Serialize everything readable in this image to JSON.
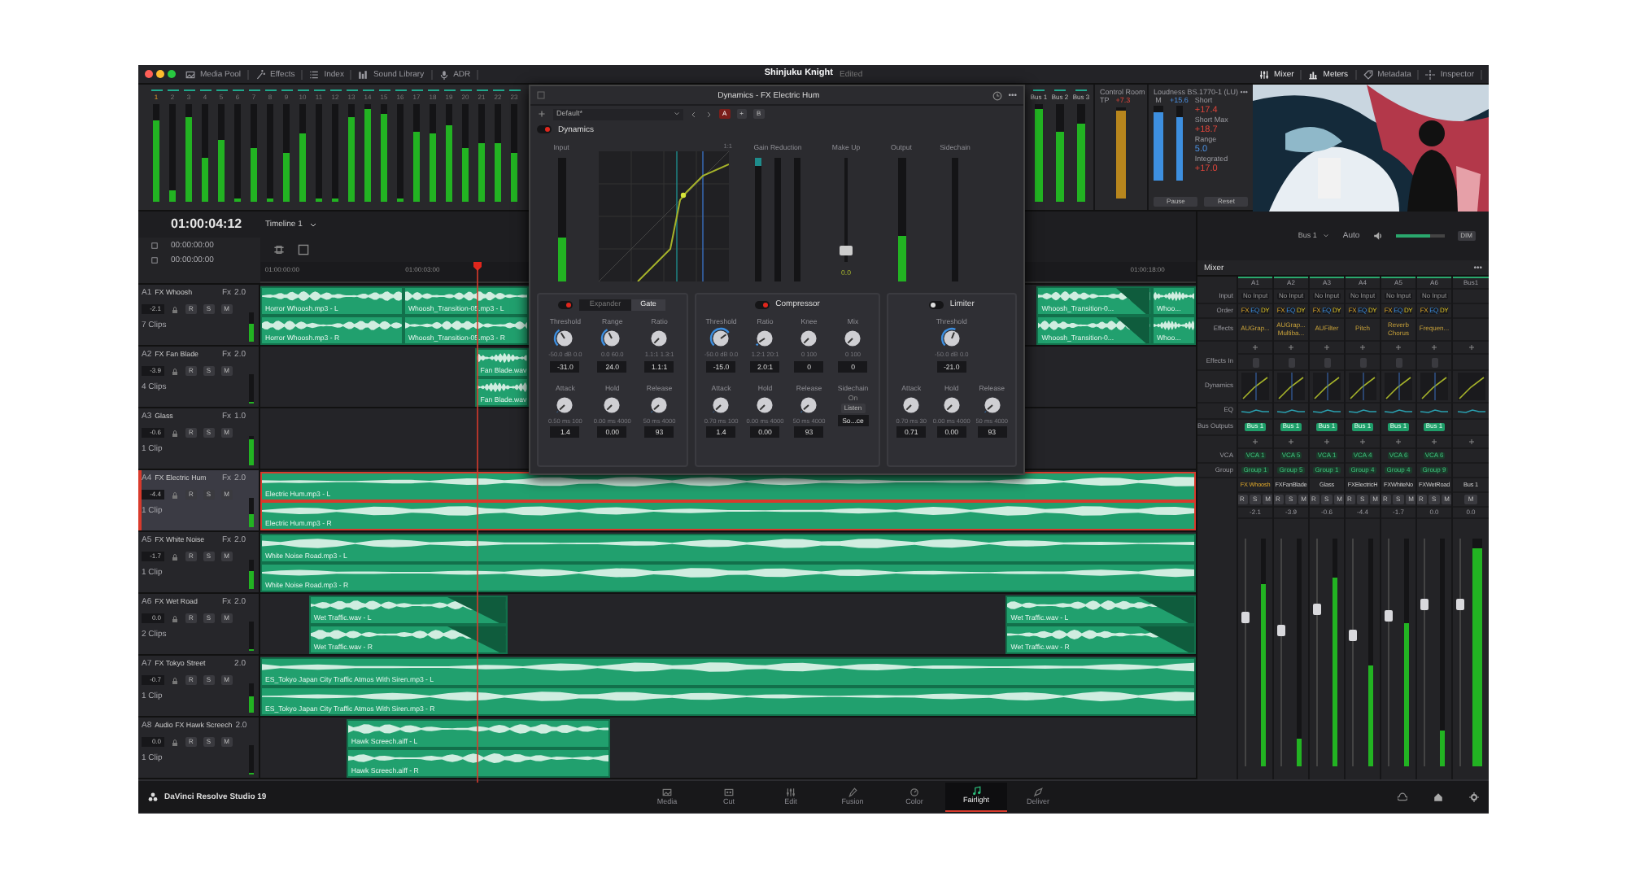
{
  "toolbar": {
    "left": [
      {
        "label": "Media Pool"
      },
      {
        "label": "Effects"
      },
      {
        "label": "Index"
      },
      {
        "label": "Sound Library"
      },
      {
        "label": "ADR"
      }
    ],
    "project_title": "Shinjuku Knight",
    "project_status": "Edited",
    "right": [
      {
        "label": "Mixer",
        "selected": true
      },
      {
        "label": "Meters",
        "selected": true
      },
      {
        "label": "Metadata",
        "selected": false
      },
      {
        "label": "Inspector",
        "selected": false
      }
    ]
  },
  "channel_meters": [
    {
      "label": "1",
      "selected": true,
      "level": 0.83
    },
    {
      "label": "2",
      "selected": false,
      "level": 0.12
    },
    {
      "label": "3",
      "selected": false,
      "level": 0.86
    },
    {
      "label": "4",
      "selected": false,
      "level": 0.45
    },
    {
      "label": "5",
      "selected": false,
      "level": 0.64
    },
    {
      "label": "6",
      "selected": false,
      "level": 0.03
    },
    {
      "label": "7",
      "selected": false,
      "level": 0.55
    },
    {
      "label": "8",
      "selected": false,
      "level": 0.03
    },
    {
      "label": "9",
      "selected": false,
      "level": 0.5
    },
    {
      "label": "10",
      "selected": false,
      "level": 0.7
    },
    {
      "label": "11",
      "selected": false,
      "level": 0.03
    },
    {
      "label": "12",
      "selected": false,
      "level": 0.03
    },
    {
      "label": "13",
      "selected": false,
      "level": 0.86
    },
    {
      "label": "14",
      "selected": false,
      "level": 0.95
    },
    {
      "label": "15",
      "selected": false,
      "level": 0.9
    },
    {
      "label": "16",
      "selected": false,
      "level": 0.03
    },
    {
      "label": "17",
      "selected": false,
      "level": 0.72
    },
    {
      "label": "18",
      "selected": false,
      "level": 0.7
    },
    {
      "label": "19",
      "selected": false,
      "level": 0.78
    },
    {
      "label": "20",
      "selected": false,
      "level": 0.55
    },
    {
      "label": "21",
      "selected": false,
      "level": 0.6
    },
    {
      "label": "22",
      "selected": false,
      "level": 0.6
    },
    {
      "label": "23",
      "selected": false,
      "level": 0.5
    }
  ],
  "bus_meters": [
    {
      "label": "Bus 1",
      "level": 0.95
    },
    {
      "label": "Bus 2",
      "level": 0.72
    },
    {
      "label": "Bus 3",
      "level": 0.8
    }
  ],
  "control_room": {
    "title": "Control Room",
    "tp_label": "TP",
    "tp_value": "+7.3",
    "level": 0.96
  },
  "loudness": {
    "title": "Loudness",
    "standard": "BS.1770-1 (LU)",
    "menu": "•••",
    "meters": [
      {
        "label": "M",
        "level": 0.9
      },
      {
        "label": "+15.6",
        "level": 0.84
      }
    ],
    "readings": [
      {
        "label": "Short",
        "value": "+17.4",
        "color": "#e0443a"
      },
      {
        "label": "Short Max",
        "value": "+18.7",
        "color": "#e0443a"
      },
      {
        "label": "Range",
        "value": "5.0",
        "color": "#4a8fe0"
      },
      {
        "label": "Integrated",
        "value": "+17.0",
        "color": "#e0443a"
      }
    ],
    "buttons": [
      "Pause",
      "Reset"
    ]
  },
  "viewer": {
    "kind": "picture"
  },
  "timecode": "01:00:04:12",
  "timeline": {
    "label": "Timeline 1"
  },
  "timecode_rows": [
    "00:00:00:00",
    "00:00:00:00"
  ],
  "ruler": [
    "01:00:00:00",
    "01:00:03:00",
    "01:00:18:00"
  ],
  "tracks": [
    {
      "id": "A1",
      "name": "FX Whoosh",
      "fx": "Fx",
      "channels": "2.0",
      "volume": "-2.1",
      "clip_count": "7 Clips",
      "selected": false,
      "buttons": [
        "R",
        "S",
        "M"
      ],
      "level": 0.62,
      "clips": [
        {
          "left": "Horror Whoosh.mp3 - L",
          "right": "Horror Whoosh.mp3 - R",
          "fade_out": false
        },
        {
          "left": "Whoosh_Transition-05.mp3 - L",
          "right": "Whoosh_Transition-05.mp3 - R",
          "fade_out": false
        },
        {
          "left": "Whoosh_Transition-0...",
          "right": "Whoosh_Transition-0...",
          "fade_out": true
        },
        {
          "left": "Whoo...",
          "right": "Whoo...",
          "fade_out": false
        }
      ]
    },
    {
      "id": "A2",
      "name": "FX Fan Blade",
      "fx": "Fx",
      "channels": "2.0",
      "volume": "-3.9",
      "clip_count": "4 Clips",
      "selected": false,
      "buttons": [
        "R",
        "S",
        "M"
      ],
      "level": 0.08,
      "clips": [
        {
          "left": "Fan Blade.wav",
          "right": "Fan Blade.wav",
          "fade_out": false
        }
      ]
    },
    {
      "id": "A3",
      "name": "Glass",
      "fx": "Fx",
      "channels": "1.0",
      "volume": "-0.6",
      "clip_count": "1 Clip",
      "selected": false,
      "buttons": [
        "R",
        "S",
        "M"
      ],
      "level": 0.9
    },
    {
      "id": "A4",
      "name": "FX Electric Hum",
      "fx": "Fx",
      "channels": "2.0",
      "volume": "-4.4",
      "clip_count": "1 Clip",
      "selected": true,
      "buttons": [
        "R",
        "S",
        "M"
      ],
      "level": 0.45,
      "clips": [
        {
          "left": "Electric Hum.mp3 - L",
          "right": "Electric Hum.mp3 - R",
          "fade_out": false
        }
      ]
    },
    {
      "id": "A5",
      "name": "FX White Noise",
      "fx": "Fx",
      "channels": "2.0",
      "volume": "-1.7",
      "clip_count": "1 Clip",
      "selected": false,
      "buttons": [
        "R",
        "S",
        "M"
      ],
      "level": 0.62,
      "clips": [
        {
          "left": "White Noise Road.mp3 - L",
          "right": "White Noise Road.mp3 - R",
          "fade_out": false
        }
      ]
    },
    {
      "id": "A6",
      "name": "FX Wet Road",
      "fx": "Fx",
      "channels": "2.0",
      "volume": "0.0",
      "clip_count": "2 Clips",
      "selected": false,
      "buttons": [
        "R",
        "S",
        "M"
      ],
      "level": 0.03,
      "clips": [
        {
          "left": "Wet Traffic.wav - L",
          "right": "Wet Traffic.wav - R",
          "fade_out": true
        },
        {
          "left": "Wet Traffic.wav - L",
          "right": "Wet Traffic.wav - R",
          "fade_out": true
        }
      ]
    },
    {
      "id": "A7",
      "name": "FX Tokyo Street",
      "channels": "2.0",
      "volume": "-0.7",
      "clip_count": "1 Clip",
      "selected": false,
      "buttons": [
        "R",
        "S",
        "M"
      ],
      "level": 0.55,
      "clips": [
        {
          "left": "ES_Tokyo Japan City Traffic Atmos With Siren.mp3 - L",
          "right": "ES_Tokyo Japan City Traffic Atmos With Siren.mp3 - R",
          "fade_out": false
        }
      ]
    },
    {
      "id": "A8",
      "name": "Audio FX Hawk Screech",
      "channels": "2.0",
      "volume": "0.0",
      "clip_count": "1 Clip",
      "selected": false,
      "buttons": [
        "R",
        "S",
        "M"
      ],
      "level": 0.03,
      "clips": [
        {
          "left": "Hawk Screech.aiff - L",
          "right": "Hawk Screech.aiff - R",
          "fade_out": false
        }
      ]
    }
  ],
  "dynamics": {
    "title": "Dynamics - FX Electric Hum",
    "preset": "Default*",
    "ab": [
      {
        "label": "A",
        "selected": true
      },
      {
        "label": "+",
        "selected": false
      },
      {
        "label": "B",
        "selected": false
      }
    ],
    "enabled": true,
    "label": "Dynamics",
    "input": {
      "label": "Input",
      "level": 0.36
    },
    "ratio_label": "1:1",
    "gain_reduction": {
      "label": "Gain Reduction",
      "level": 0.06
    },
    "make_up": {
      "label": "Make Up",
      "value": "0.0",
      "level": 0.08
    },
    "output": {
      "label": "Output",
      "level": 0.37
    },
    "sidechain": {
      "label": "Sidechain"
    },
    "sections": [
      {
        "kind": "gate",
        "enabled": true,
        "modes": [
          {
            "label": "Expander",
            "selected": false
          },
          {
            "label": "Gate",
            "selected": true
          }
        ],
        "knobs": [
          {
            "label": "Threshold",
            "scale": "-50.0 dB 0.0",
            "value": "-31.0"
          },
          {
            "label": "Range",
            "scale": "0.0 60.0",
            "value": "24.0"
          },
          {
            "label": "Ratio",
            "scale": "1.1:1 1.3:1",
            "value": "1.1:1"
          },
          {
            "label": "Attack",
            "scale": "0.50 ms 100",
            "value": "1.4"
          },
          {
            "label": "Hold",
            "scale": "0.00 ms 4000",
            "value": "0.00"
          },
          {
            "label": "Release",
            "scale": "50 ms 4000",
            "value": "93"
          }
        ]
      },
      {
        "kind": "compressor",
        "label": "Compressor",
        "enabled": true,
        "knobs": [
          {
            "label": "Threshold",
            "scale": "-50.0 dB 0.0",
            "value": "-15.0"
          },
          {
            "label": "Ratio",
            "scale": "1.2:1 20:1",
            "value": "2.0:1"
          },
          {
            "label": "Knee",
            "scale": "0 100",
            "value": "0"
          },
          {
            "label": "Mix",
            "scale": "0 100",
            "value": "0"
          },
          {
            "label": "Attack",
            "scale": "0.70 ms 100",
            "value": "1.4"
          },
          {
            "label": "Hold",
            "scale": "0.00 ms 4000",
            "value": "0.00"
          },
          {
            "label": "Release",
            "scale": "50 ms 4000",
            "value": "93"
          }
        ],
        "sidechain": {
          "label": "Sidechain",
          "on": "On",
          "listen": "Listen",
          "source": "So...ce"
        }
      },
      {
        "kind": "limiter",
        "label": "Limiter",
        "enabled": false,
        "knobs": [
          {
            "label": "Threshold",
            "scale": "-50.0 dB 0.0",
            "value": "-21.0"
          },
          {
            "label": "Attack",
            "scale": "0.70 ms 30",
            "value": "0.71"
          },
          {
            "label": "Hold",
            "scale": "0.00 ms 4000",
            "value": "0.00"
          },
          {
            "label": "Release",
            "scale": "50 ms 4000",
            "value": "93"
          }
        ]
      }
    ]
  },
  "monitor": {
    "bus": "Bus 1",
    "mode": "Auto",
    "dim": "DIM",
    "level": 0.7
  },
  "mixer": {
    "title": "Mixer",
    "menu": "•••",
    "row_labels": [
      "Input",
      "Order",
      "Effects",
      "Effects In",
      "Dynamics",
      "EQ",
      "Bus Outputs",
      "VCA",
      "Group"
    ],
    "strips": [
      {
        "kind": "track",
        "id": "A1",
        "input": "No Input",
        "order": [
          "FX",
          "EQ",
          "DY"
        ],
        "effects": [
          "AUGrap..."
        ],
        "bus_output": "Bus 1",
        "vca": "VCA 1",
        "group": "Group 1",
        "name": "FX Whoosh",
        "selected": true,
        "buttons": [
          "R",
          "S",
          "M"
        ],
        "volume": "-2.1",
        "fader": {
          "level": 0.66
        },
        "meter": {
          "level": 0.8
        }
      },
      {
        "kind": "track",
        "id": "A2",
        "input": "No Input",
        "order": [
          "FX",
          "EQ",
          "DY"
        ],
        "effects": [
          "AUGrap...",
          "Multiba..."
        ],
        "bus_output": "Bus 1",
        "vca": "VCA 5",
        "group": "Group 5",
        "name": "FXFanBlade",
        "selected": false,
        "buttons": [
          "R",
          "S",
          "M"
        ],
        "volume": "-3.9",
        "fader": {
          "level": 0.6
        },
        "meter": {
          "level": 0.12
        }
      },
      {
        "kind": "track",
        "id": "A3",
        "input": "No Input",
        "order": [
          "FX",
          "EQ",
          "DY"
        ],
        "effects": [
          "AUFilter"
        ],
        "bus_output": "Bus 1",
        "vca": "VCA 1",
        "group": "Group 1",
        "name": "Glass",
        "selected": false,
        "buttons": [
          "R",
          "S",
          "M"
        ],
        "volume": "-0.6",
        "fader": {
          "level": 0.7
        },
        "meter": {
          "level": 0.83
        }
      },
      {
        "kind": "track",
        "id": "A4",
        "input": "No Input",
        "order": [
          "FX",
          "EQ",
          "DY"
        ],
        "effects": [
          "Pitch"
        ],
        "bus_output": "Bus 1",
        "vca": "VCA 4",
        "group": "Group 4",
        "name": "FXElectricH",
        "selected": false,
        "buttons": [
          "R",
          "S",
          "M"
        ],
        "volume": "-4.4",
        "fader": {
          "level": 0.58
        },
        "meter": {
          "level": 0.44
        }
      },
      {
        "kind": "track",
        "id": "A5",
        "input": "No Input",
        "order": [
          "FX",
          "EQ",
          "DY"
        ],
        "effects": [
          "Reverb",
          "Chorus"
        ],
        "bus_output": "Bus 1",
        "vca": "VCA 6",
        "group": "Group 4",
        "name": "FXWhiteNo",
        "selected": false,
        "buttons": [
          "R",
          "S",
          "M"
        ],
        "volume": "-1.7",
        "fader": {
          "level": 0.67
        },
        "meter": {
          "level": 0.63
        }
      },
      {
        "kind": "track",
        "id": "A6",
        "input": "No Input",
        "order": [
          "FX",
          "EQ",
          "DY"
        ],
        "effects": [
          "Frequen..."
        ],
        "bus_output": "Bus 1",
        "vca": "VCA 6",
        "group": "Group 9",
        "name": "FXWetRoad",
        "selected": false,
        "buttons": [
          "R",
          "S",
          "M"
        ],
        "volume": "0.0",
        "fader": {
          "level": 0.72
        },
        "meter": {
          "level": 0.16
        }
      },
      {
        "kind": "bus",
        "id": "Bus1",
        "name": "Bus 1",
        "selected": false,
        "buttons": [
          "M"
        ],
        "volume": "0.0",
        "fader": {
          "level": 0.72
        },
        "meter": {
          "level": 0.96
        }
      }
    ]
  },
  "pages": [
    {
      "label": "Media",
      "selected": false
    },
    {
      "label": "Cut",
      "selected": false
    },
    {
      "label": "Edit",
      "selected": false
    },
    {
      "label": "Fusion",
      "selected": false
    },
    {
      "label": "Color",
      "selected": false
    },
    {
      "label": "Fairlight",
      "selected": true
    },
    {
      "label": "Deliver",
      "selected": false
    }
  ],
  "brand": "DaVinci Resolve Studio 19"
}
